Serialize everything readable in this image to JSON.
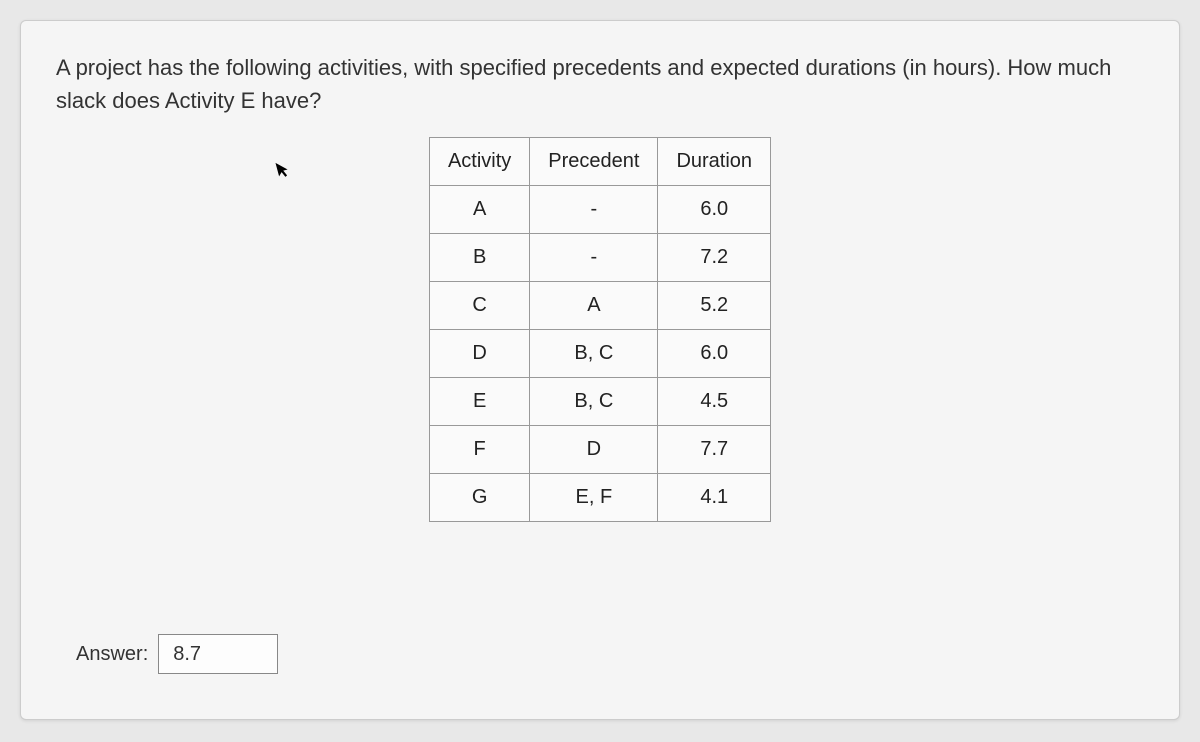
{
  "question": "A project has the following activities, with specified precedents and expected durations (in hours). How much slack does Activity E have?",
  "table": {
    "headers": [
      "Activity",
      "Precedent",
      "Duration"
    ],
    "rows": [
      {
        "activity": "A",
        "precedent": "-",
        "duration": "6.0"
      },
      {
        "activity": "B",
        "precedent": "-",
        "duration": "7.2"
      },
      {
        "activity": "C",
        "precedent": "A",
        "duration": "5.2"
      },
      {
        "activity": "D",
        "precedent": "B, C",
        "duration": "6.0"
      },
      {
        "activity": "E",
        "precedent": "B, C",
        "duration": "4.5"
      },
      {
        "activity": "F",
        "precedent": "D",
        "duration": "7.7"
      },
      {
        "activity": "G",
        "precedent": "E, F",
        "duration": "4.1"
      }
    ]
  },
  "answer": {
    "label": "Answer:",
    "value": "8.7"
  }
}
